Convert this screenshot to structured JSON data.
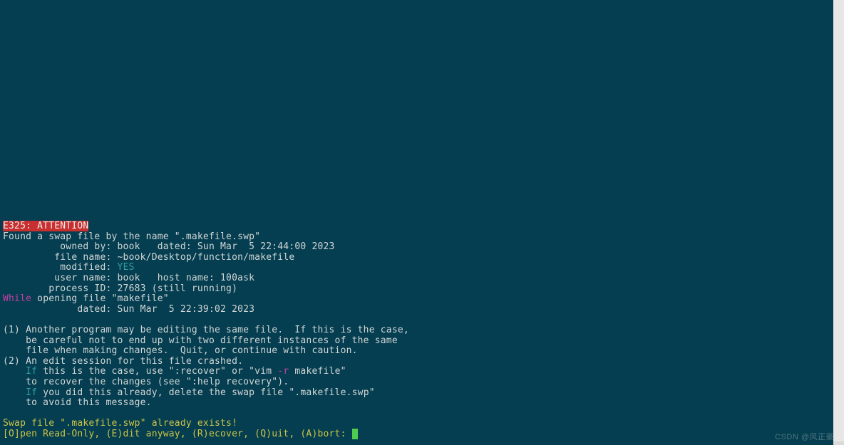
{
  "colors": {
    "terminal_bg": "#043e50",
    "text_default": "#d2d6d6",
    "attention_bg": "#c92f2f",
    "attention_fg": "#efefef",
    "teal_highlight": "#31a0a0",
    "magenta_highlight": "#c140a4",
    "yellow_highlight": "#cdc447",
    "cursor": "#4fcb4f",
    "scrollbar": "#e9e7e5"
  },
  "attention": "E325: ATTENTION",
  "found_line": "Found a swap file by the name \".makefile.swp\"",
  "owned_line": "          owned by: book   dated: Sun Mar  5 22:44:00 2023",
  "file_name_line": "         file name: ~book/Desktop/function/makefile",
  "modified_label": "          modified: ",
  "modified_value": "YES",
  "user_host_line": "         user name: book   host name: 100ask",
  "process_line": "        process ID: 27683 (still running)",
  "while_word": "While",
  "while_rest": " opening file \"makefile\"",
  "dated_line": "             dated: Sun Mar  5 22:39:02 2023",
  "blank_line": "",
  "para1_l1": "(1) Another program may be editing the same file.  If this is the case,",
  "para1_l2": "    be careful not to end up with two different instances of the same",
  "para1_l3": "    file when making changes.  Quit, or continue with caution.",
  "para2_l1": "(2) An edit session for this file crashed.",
  "if_word": "If",
  "para2_l2_indent": "    ",
  "para2_l2_a": " this is the case, use \":recover\" or \"vim ",
  "para2_l2_r": "-r",
  "para2_l2_b": " makefile\"",
  "para2_l3": "    to recover the changes (see \":help recovery\").",
  "para2_l4_a": " you did this already, delete the swap file \".makefile.swp\"",
  "para2_l5": "    to avoid this message.",
  "swap_exists": "Swap file \".makefile.swp\" already exists!",
  "prompt_line": "[O]pen Read-Only, (E)dit anyway, (R)ecover, (Q)uit, (A)bort: ",
  "cursor_char": " ",
  "watermark": "CSDN @风正豪"
}
